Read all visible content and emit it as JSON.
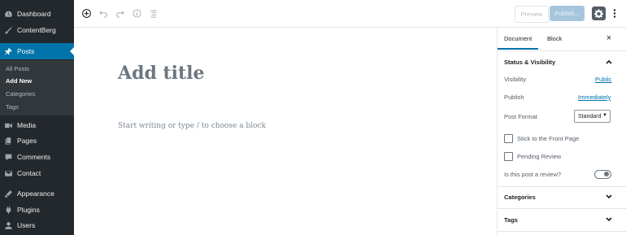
{
  "admin_menu": {
    "items": [
      {
        "label": "Dashboard",
        "icon": "dashboard-icon"
      },
      {
        "label": "ContentBerg",
        "icon": "brush-icon"
      },
      {
        "label": "Posts",
        "icon": "pin-icon",
        "active": true
      },
      {
        "label": "Media",
        "icon": "media-icon"
      },
      {
        "label": "Pages",
        "icon": "pages-icon"
      },
      {
        "label": "Comments",
        "icon": "comments-icon"
      },
      {
        "label": "Contact",
        "icon": "mail-icon"
      },
      {
        "label": "Appearance",
        "icon": "appearance-icon"
      },
      {
        "label": "Plugins",
        "icon": "plugins-icon"
      },
      {
        "label": "Users",
        "icon": "users-icon"
      }
    ],
    "posts_submenu": [
      "All Posts",
      "Add New",
      "Categories",
      "Tags"
    ],
    "current_submenu": "Add New"
  },
  "toolbar": {
    "icons": [
      "add-block-icon",
      "undo-icon",
      "redo-icon",
      "info-icon",
      "list-view-icon"
    ],
    "preview_label": "Preview",
    "publish_label": "Publish...",
    "settings_icon": "gear-icon",
    "more_icon": "more-vertical-icon"
  },
  "editor": {
    "title_placeholder": "Add title",
    "body_placeholder": "Start writing or type / to choose a block"
  },
  "settings_sidebar": {
    "tabs": {
      "document": "Document",
      "block": "Block"
    },
    "active_tab": "Document",
    "close_symbol": "×",
    "status_panel": {
      "title": "Status & Visibility",
      "visibility_label": "Visibility",
      "visibility_value": "Public",
      "publish_label": "Publish",
      "publish_value": "Immediately",
      "post_format_label": "Post Format",
      "post_format_value": "Standard",
      "stick_label": "Stick to the Front Page",
      "pending_label": "Pending Review",
      "review_label": "Is this post a review?"
    },
    "categories_title": "Categories",
    "tags_title": "Tags"
  },
  "colors": {
    "sidebar_bg": "#23282d",
    "accent": "#0073aa",
    "publish_disabled": "#a6c6dd"
  }
}
